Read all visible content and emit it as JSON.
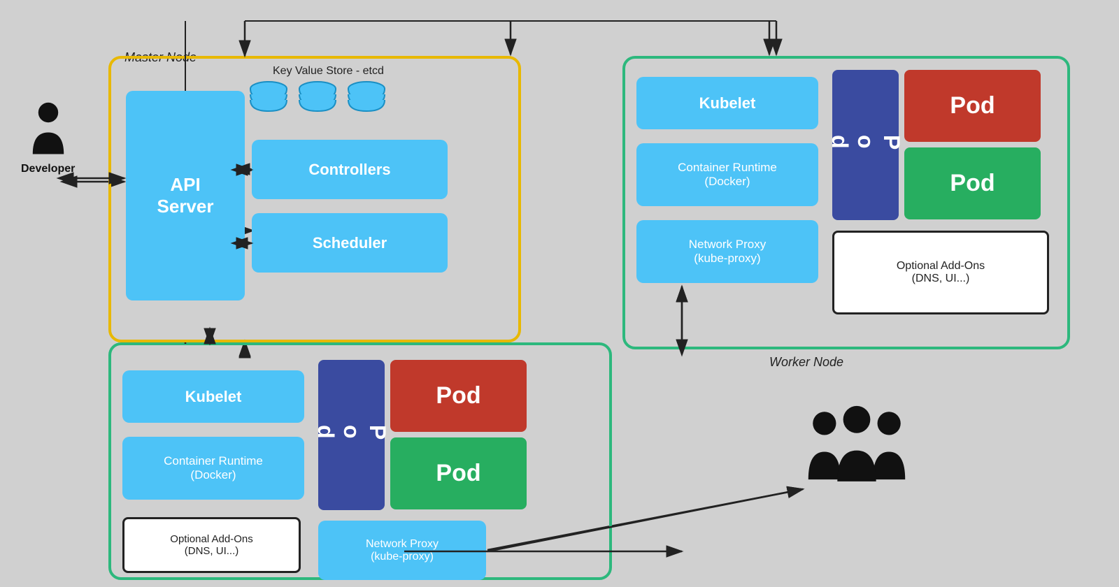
{
  "background_color": "#d0d0d0",
  "master_node": {
    "label": "Master Node",
    "api_server": "API\nServer",
    "etcd_label": "Key Value Store - etcd",
    "controllers": "Controllers",
    "scheduler": "Scheduler"
  },
  "worker_node_top": {
    "label": "Worker Node",
    "kubelet": "Kubelet",
    "container_runtime": "Container Runtime\n(Docker)",
    "network_proxy": "Network Proxy\n(kube-proxy)",
    "pod_blue": "P\no\nd",
    "pod_red": "Pod",
    "pod_green": "Pod",
    "optional_addons_line1": "Optional Add-Ons",
    "optional_addons_line2": "(DNS, UI...)"
  },
  "worker_node_bottom": {
    "kubelet": "Kubelet",
    "container_runtime": "Container Runtime\n(Docker)",
    "pod_blue": "P\no\nd",
    "pod_red": "Pod",
    "pod_green": "Pod",
    "optional_addons_line1": "Optional Add-Ons",
    "optional_addons_line2": "(DNS, UI...)",
    "network_proxy": "Network Proxy\n(kube-proxy)"
  },
  "developer": {
    "label": "Developer"
  },
  "users": {
    "label": ""
  }
}
